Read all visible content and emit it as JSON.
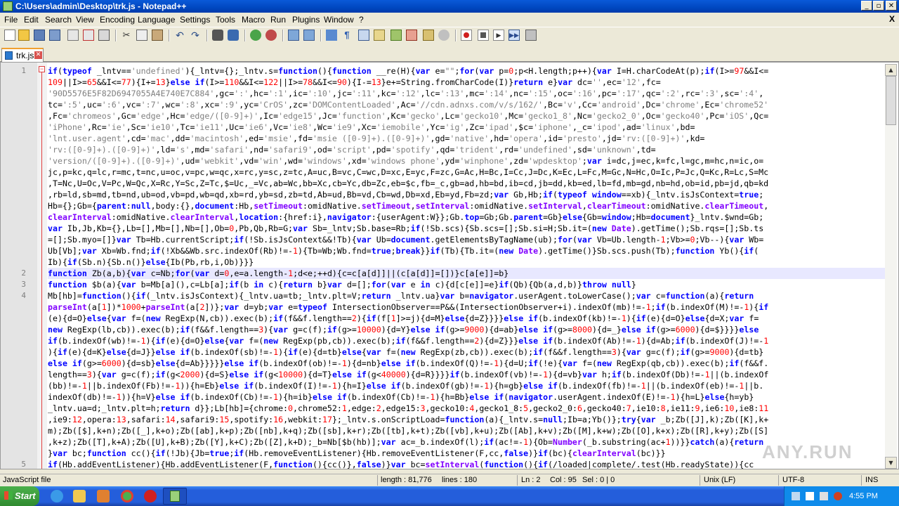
{
  "window": {
    "title": "C:\\Users\\admin\\Desktop\\trk.js - Notepad++"
  },
  "menu": [
    "File",
    "Edit",
    "Search",
    "View",
    "Encoding",
    "Language",
    "Settings",
    "Tools",
    "Macro",
    "Run",
    "Plugins",
    "Window",
    "?"
  ],
  "close_all_x": "X",
  "tabs": [
    {
      "label": "trk.js"
    }
  ],
  "editor": {
    "lines": [
      {
        "num": "1",
        "html": "<b>if</b>(<b>typeof</b> _lntv==<i>'undefined'</i>){_lntv={};_lntv.s=<b>function</b>(){<b>function</b> __re(H){<b>var</b> e=<i>\"\"</i>;<b>for</b>(<b>var</b> p=<u>0</u>;p&lt;H.length;p++){<b>var</b> I=H.charCodeAt(p);<b>if</b>(I&gt;=<u>97</u>&amp;&amp;I&lt;="
      },
      {
        "num": "",
        "html": "<u>109</u>||I&gt;=<u>65</u>&amp;&amp;I&lt;=<u>77</u>){I+=<u>13</u>}<b>else</b> <b>if</b>(I&gt;=<u>110</u>&amp;&amp;I&lt;=<u>122</u>||I&gt;=<u>78</u>&amp;&amp;I&lt;=<u>90</u>){I-=<u>13</u>}e+=String.fromCharCode(I)}<b>return</b> e}<b>var</b> dc=<i>''</i>,ec=<i>'12'</i>,fc="
      },
      {
        "num": "",
        "html": "<i>'90D5576E5F82D6947055A4E740E7C884'</i>,gc=<i>':'</i>,hc=<i>':1'</i>,ic=<i>':10'</i>,jc=<i>':11'</i>,kc=<i>':12'</i>,lc=<i>':13'</i>,mc=<i>':14'</i>,nc=<i>':15'</i>,oc=<i>':16'</i>,pc=<i>':17'</i>,qc=<i>':2'</i>,rc=<i>':3'</i>,sc=<i>':4'</i>,"
      },
      {
        "num": "",
        "html": "tc=<i>':5'</i>,uc=<i>':6'</i>,vc=<i>':7'</i>,wc=<i>':8'</i>,xc=<i>':9'</i>,yc=<i>'CrOS'</i>,zc=<i>'DOMContentLoaded'</i>,Ac=<i>'//cdn.adnxs.com/v/s/162/'</i>,Bc=<i>'v'</i>,Cc=<i>'android'</i>,Dc=<i>'chrome'</i>,Ec=<i>'chrome52'</i>"
      },
      {
        "num": "",
        "html": ",Fc=<i>'chromeos'</i>,Gc=<i>'edge'</i>,Hc=<i>'edge/([0-9]+)'</i>,Ic=<i>'edge15'</i>,Jc=<i>'function'</i>,Kc=<i>'gecko'</i>,Lc=<i>'gecko10'</i>,Mc=<i>'gecko1_8'</i>,Nc=<i>'gecko2_0'</i>,Oc=<i>'gecko40'</i>,Pc=<i>'iOS'</i>,Qc="
      },
      {
        "num": "",
        "html": "<i>'iPhone'</i>,Rc=<i>'ie'</i>,Sc=<i>'ie10'</i>,Tc=<i>'ie11'</i>,Uc=<i>'ie6'</i>,Vc=<i>'ie8'</i>,Wc=<i>'ie9'</i>,Xc=<i>'iemobile'</i>,Yc=<i>'ig'</i>,Zc=<i>'ipad'</i>,$c=<i>'iphone'</i>,_c=<i>'ipod'</i>,ad=<i>'linux'</i>,bd="
      },
      {
        "num": "",
        "html": "<i>'lnt.user.agent'</i>,cd=<i>'mac'</i>,dd=<i>'macintosh'</i>,ed=<i>'msie'</i>,fd=<i>'msie ([0-9]+).([0-9]+)'</i>,gd=<i>'native'</i>,hd=<i>'opera'</i>,id=<i>'presto'</i>,jd=<i>'rv:([0-9]+)'</i>,kd="
      },
      {
        "num": "",
        "html": "<i>'rv:([0-9]+).([0-9]+)'</i>,ld=<i>'s'</i>,md=<i>'safari'</i>,nd=<i>'safari9'</i>,od=<i>'script'</i>,pd=<i>'spotify'</i>,qd=<i>'trident'</i>,rd=<i>'undefined'</i>,sd=<i>'unknown'</i>,td="
      },
      {
        "num": "",
        "html": "<i>'version/([0-9]+).([0-9]+)'</i>,ud=<i>'webkit'</i>,vd=<i>'win'</i>,wd=<i>'windows'</i>,xd=<i>'windows phone'</i>,yd=<i>'winphone'</i>,zd=<i>'wpdesktop'</i>;<b>var</b> i=dc,j=ec,k=fc,l=gc,m=hc,n=ic,o="
      },
      {
        "num": "",
        "html": "jc,p=kc,q=lc,r=mc,t=nc,u=oc,v=pc,w=qc,x=rc,y=sc,z=tc,A=uc,B=vc,C=wc,D=xc,E=yc,F=zc,G=Ac,H=Bc,I=Cc,J=Dc,K=Ec,L=Fc,M=Gc,N=Hc,O=Ic,P=Jc,Q=Kc,R=Lc,S=Mc"
      },
      {
        "num": "",
        "html": ",T=Nc,U=Oc,V=Pc,W=Qc,X=Rc,Y=Sc,Z=Tc,$=Uc,_=Vc,ab=Wc,bb=Xc,cb=Yc,db=Zc,eb=$c,fb=_c,gb=ad,hb=bd,ib=cd,jb=dd,kb=ed,lb=fd,mb=gd,nb=hd,ob=id,pb=jd,qb=kd"
      },
      {
        "num": "",
        "html": ",rb=ld,sb=md,tb=nd,ub=od,vb=pd,wb=qd,xb=rd,yb=sd,zb=td,Ab=ud,Bb=vd,Cb=wd,Db=xd,Eb=yd,Fb=zd;<b>var</b> Gb,Hb;<b>if</b>(<b>typeof</b> <b>window</b>==xb){_lntv.isJsContext=<b>true</b>;"
      },
      {
        "num": "",
        "html": "Hb={};Gb={<b>parent</b>:<b>null</b>,body:{},<b>document</b>:Hb,<s>setTimeout</s>:omidNative.<s>setTimeout</s>,<s>setInterval</s>:omidNative.<s>setInterval</s>,<s>clearTimeout</s>:omidNative.<s>clearTimeout</s>,"
      },
      {
        "num": "",
        "html": "<s>clearInterval</s>:omidNative.<s>clearInterval</s>,<b>location</b>:{href:i},<b>navigator</b>:{userAgent:W}};Gb.<b>top</b>=Gb;Gb.<b>parent</b>=Gb}<b>else</b>{Gb=<b>window</b>;Hb=<b>document</b>}_lntv.$wnd=Gb;"
      },
      {
        "num": "",
        "html": "<b>var</b> Ib,Jb,Kb={},Lb=[],Mb=[],Nb=[],Ob=<u>0</u>,Pb,Qb,Rb=G;<b>var</b> Sb=_lntv;Sb.base=Rb;<b>if</b>(!Sb.scs){Sb.scs=[];Sb.si=H;Sb.it=(<b>new</b> <s>Date</s>).getTime();Sb.rqs=[];Sb.ts"
      },
      {
        "num": "",
        "html": "=[];Sb.myo=[]}<b>var</b> Tb=Hb.currentScript;<b>if</b>(!Sb.isJsContext&amp;&amp;!Tb){<b>var</b> Ub=<b>document</b>.getElementsByTagName(ub);<b>for</b>(<b>var</b> Vb=Ub.length-<u>1</u>;Vb&gt;=<u>0</u>;Vb--){<b>var</b> Wb="
      },
      {
        "num": "",
        "html": "Ub[Vb];<b>var</b> Xb=Wb.fnd;<b>if</b>(!Xb&amp;&amp;Wb.src.indexOf(Rb)!=-<u>1</u>){Tb=Wb;Wb.fnd=<b>true</b>;<b>break</b>}}<b>if</b>(Tb){Tb.it=(<b>new</b> <s>Date</s>).getTime()}Sb.scs.push(Tb);<b>function</b> Yb(){<b>if</b>("
      },
      {
        "num": "",
        "html": "Ib){<b>if</b>(Sb.n){Sb.n()}<b>else</b>{Ib(Pb,rb,i,Ob)}}}"
      },
      {
        "num": "2",
        "cur": true,
        "html": "<b>function</b> Zb(a,b){<b>var</b> c=Nb;<b>for</b>(<b>var</b> d=<u>0</u>,e=a.length-<u>1</u>;d&lt;e;++d){c=c[a[d]]||(c[a[d]]=[])}c[a[e]]=b}"
      },
      {
        "num": "3",
        "html": "<b>function</b> $b(a){<b>var</b> b=Mb[a](),c=Lb[a];<b>if</b>(b <b>in</b> c){<b>return</b> b}<b>var</b> d=[];<b>for</b>(<b>var</b> e <b>in</b> c){d[c[e]]=e}<b>if</b>(Qb){Qb(a,d,b)}<b>throw</b> <b>null</b>}"
      },
      {
        "num": "4",
        "html": "Mb[hb]=<b>function</b>(){<b>if</b>(_lntv.isJsContext){_lntv.ua=tb;_lntv.plt=V;<b>return</b> _lntv.ua}<b>var</b> b=<b>navigator</b>.userAgent.toLowerCase();<b>var</b> c=<b>function</b>(a){<b>return</b>"
      },
      {
        "num": "",
        "html": "<s>parseInt</s>(a[<u>1</u>])*<u>1000</u>+<s>parseInt</s>(a[<u>2</u>])};<b>var</b> d=yb;<b>var</b> e=<b>typeof</b> IntersectionObserver==P&amp;&amp;(IntersectionObserver+i).indexOf(mb)!=-<u>1</u>;<b>if</b>(b.indexOf(M)!=-<u>1</u>){<b>if</b>"
      },
      {
        "num": "",
        "html": "(e){d=O}<b>else</b>{<b>var</b> f=(<b>new</b> RegExp(N,cb)).exec(b);<b>if</b>(f&amp;&amp;f.length==<u>2</u>){<b>if</b>(f[<u>1</u>]&gt;=j){d=M}<b>else</b>{d=Z}}}}<b>else</b> <b>if</b>(b.indexOf(kb)!=-<u>1</u>){<b>if</b>(e){d=O}<b>else</b>{d=X;<b>var</b> f="
      },
      {
        "num": "",
        "html": "<b>new</b> RegExp(lb,cb)).exec(b);<b>if</b>(f&amp;&amp;f.length==<u>3</u>){<b>var</b> g=c(f);<b>if</b>(g&gt;=<u>10000</u>){d=Y}<b>else</b> <b>if</b>(g&gt;=<u>9000</u>){d=ab}<b>else</b> <b>if</b>(g&gt;=<u>8000</u>){d=_}<b>else</b> <b>if</b>(g&gt;=<u>6000</u>){d=$}}}}<b>else</b>"
      },
      {
        "num": "",
        "html": "<b>if</b>(b.indexOf(wb)!=-<u>1</u>){<b>if</b>(e){d=O}<b>else</b>{<b>var</b> f=(<b>new</b> RegExp(pb,cb)).exec(b);<b>if</b>(f&amp;&amp;f.length==<u>2</u>){d=Z}}}<b>else</b> <b>if</b>(b.indexOf(Ab)!=-<u>1</u>){d=Ab;<b>if</b>(b.indexOf(J)!=-<u>1</u>"
      },
      {
        "num": "",
        "html": "){<b>if</b>(e){d=K}<b>else</b>{d=J}}<b>else</b> <b>if</b>(b.indexOf(sb)!=-<u>1</u>){<b>if</b>(e){d=tb}<b>else</b>{<b>var</b> f=(<b>new</b> RegExp(zb,cb)).exec(b);<b>if</b>(f&amp;&amp;f.length==<u>3</u>){<b>var</b> g=c(f);<b>if</b>(g&gt;=<u>9000</u>){d=tb}"
      },
      {
        "num": "",
        "html": "<b>else</b> <b>if</b>(g&gt;=<u>6000</u>){d=sb}<b>else</b>{d=Ab}}}}}<b>else</b> <b>if</b>(b.indexOf(ob)!=-<u>1</u>){d=nb}<b>else</b> <b>if</b>(b.indexOf(Q)!=-<u>1</u>){d=U;<b>if</b>(!e){<b>var</b> f=(<b>new</b> RegExp(qb,cb)).exec(b);<b>if</b>(f&amp;&amp;f."
      },
      {
        "num": "",
        "html": "length==<u>3</u>){<b>var</b> g=c(f);<b>if</b>(g&lt;<u>2000</u>){d=S}<b>else</b> <b>if</b>(g&lt;<u>10000</u>){d=T}<b>else</b> <b>if</b>(g&lt;<u>40000</u>){d=R}}}}<b>if</b>(b.indexOf(vb)!=-<u>1</u>){d=vb}<b>var</b> h;<b>if</b>(b.indexOf(Db)!=-<u>1</u>||(b.indexOf"
      },
      {
        "num": "",
        "html": "(bb)!=-<u>1</u>||b.indexOf(Fb)!=-<u>1</u>)){h=Eb}<b>else</b> <b>if</b>(b.indexOf(I)!=-<u>1</u>){h=I}<b>else</b> <b>if</b>(b.indexOf(gb)!=-<u>1</u>){h=gb}<b>else</b> <b>if</b>(b.indexOf(fb)!=-<u>1</u>||(b.indexOf(eb)!=-<u>1</u>||b."
      },
      {
        "num": "",
        "html": "indexOf(db)!=-<u>1</u>)){h=V}<b>else</b> <b>if</b>(b.indexOf(Cb)!=-<u>1</u>){h=ib}<b>else</b> <b>if</b>(b.indexOf(Cb)!=-<u>1</u>){h=Bb}<b>else</b> <b>if</b>(<b>navigator</b>.userAgent.indexOf(E)!=-<u>1</u>){h=L}<b>else</b>{h=yb}"
      },
      {
        "num": "",
        "html": "_lntv.ua=d;_lntv.plt=h;<b>return</b> d}};Lb[hb]={chrome:<u>0</u>,chrome52:<u>1</u>,edge:<u>2</u>,edge15:<u>3</u>,gecko10:<u>4</u>,gecko1_8:<u>5</u>,gecko2_0:<u>6</u>,gecko40:<u>7</u>,ie10:<u>8</u>,ie11:<u>9</u>,ie6:<u>10</u>,ie8:<u>11</u>"
      },
      {
        "num": "",
        "html": ",ie9:<u>12</u>,opera:<u>13</u>,safari:<u>14</u>,safari9:<u>15</u>,spotify:<u>16</u>,webkit:<u>17</u>};_lntv.s.onScriptLoad=<b>function</b>(a){_lntv.s=<b>null</b>;Ib=a;Yb()};<b>try</b>{<b>var</b> _b;Zb([J],k);Zb([K],k+"
      },
      {
        "num": "",
        "html": "m);Zb([$],k+n);Zb([_],k+o);Zb([ab],k+p);Zb([nb],k+q);Zb([sb],k+r);Zb([tb],k+t);Zb([vb],k+u);Zb([Ab],k+v);Zb([M],k+w);Zb([O],k+x);Zb([R],k+y);Zb([S]"
      },
      {
        "num": "",
        "html": ",k+z);Zb([T],k+A);Zb([U],k+B);Zb([Y],k+C);Zb([Z],k+D);_b=Nb[$b(hb)];<b>var</b> ac=_b.indexOf(l);<b>if</b>(ac!=-<u>1</u>){Ob=<s>Number</s>(_b.substring(ac+<u>1</u>))}}<b>catch</b>(a){<b>return</b>"
      },
      {
        "num": "",
        "html": "}<b>var</b> bc;<b>function</b> cc(){<b>if</b>(!Jb){Jb=<b>true</b>;<b>if</b>(Hb.removeEventListener){Hb.removeEventListener(F,cc,<b>false</b>)}<b>if</b>(bc){<s>clearInterval</s>(bc)}}"
      },
      {
        "num": "5",
        "html": "<b>if</b>(Hb.addEventListener){Hb.addEventListener(F,<b>function</b>(){cc()},<b>false</b>)}<b>var</b> bc=<s>setInterval</s>(<b>function</b>(){<b>if</b>(/loaded|complete/.test(Hb.readyState)){cc"
      }
    ]
  },
  "watermark": "ANY.RUN",
  "status": {
    "filetype": "JavaScript file",
    "length": "length : 81,776",
    "lines": "lines : 180",
    "ln": "Ln : 2",
    "col": "Col : 95",
    "sel": "Sel : 0 | 0",
    "eol": "Unix (LF)",
    "encoding": "UTF-8",
    "mode": "INS"
  },
  "taskbar": {
    "start": "Start",
    "clock": "4:55 PM"
  }
}
